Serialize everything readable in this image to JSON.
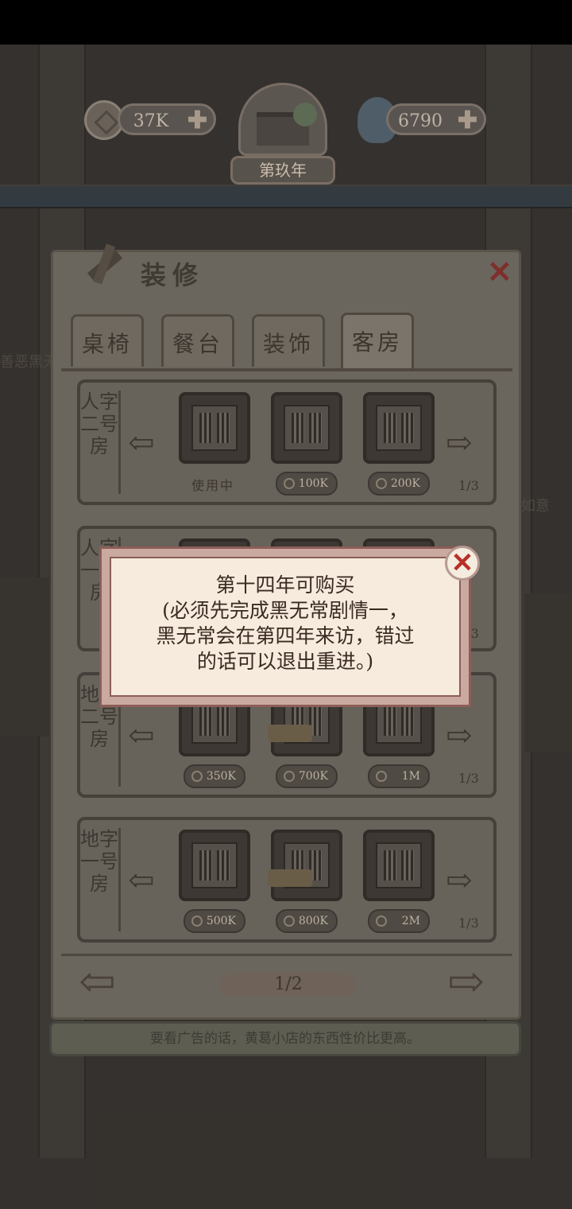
{
  "hud": {
    "coins": "37K",
    "spirit": "6790",
    "plus": "✚",
    "year": "第玖年"
  },
  "background": {
    "left_sign": "善恶黑无",
    "right_sign": "如意"
  },
  "panel": {
    "title": "装修",
    "close_glyph": "✕",
    "tabs": [
      "桌椅",
      "餐台",
      "装饰",
      "客房"
    ],
    "active_tab": "客房",
    "left_arrow": "⇦",
    "right_arrow": "⇨",
    "rooms": [
      {
        "name": "人字二号房",
        "status": "使用中",
        "prices": [
          "100K",
          "200K"
        ],
        "page": "1/3"
      },
      {
        "name": "人字一号房",
        "page": "1/3"
      },
      {
        "name": "地字二号房",
        "prices": [
          "350K",
          "700K",
          "1M"
        ],
        "page": "1/3"
      },
      {
        "name": "地字一号房",
        "prices": [
          "500K",
          "800K",
          "2M"
        ],
        "page": "1/3"
      }
    ],
    "page_indicator": "1/2"
  },
  "tip": "要看广告的话，黄葛小店的东西性价比更高。",
  "dialog": {
    "line1": "第十四年可购买",
    "line2": "(必须先完成黑无常剧情一，",
    "line3": "黑无常会在第四年来访，错过",
    "line4": "的话可以退出重进。)",
    "close_glyph": "✕"
  }
}
